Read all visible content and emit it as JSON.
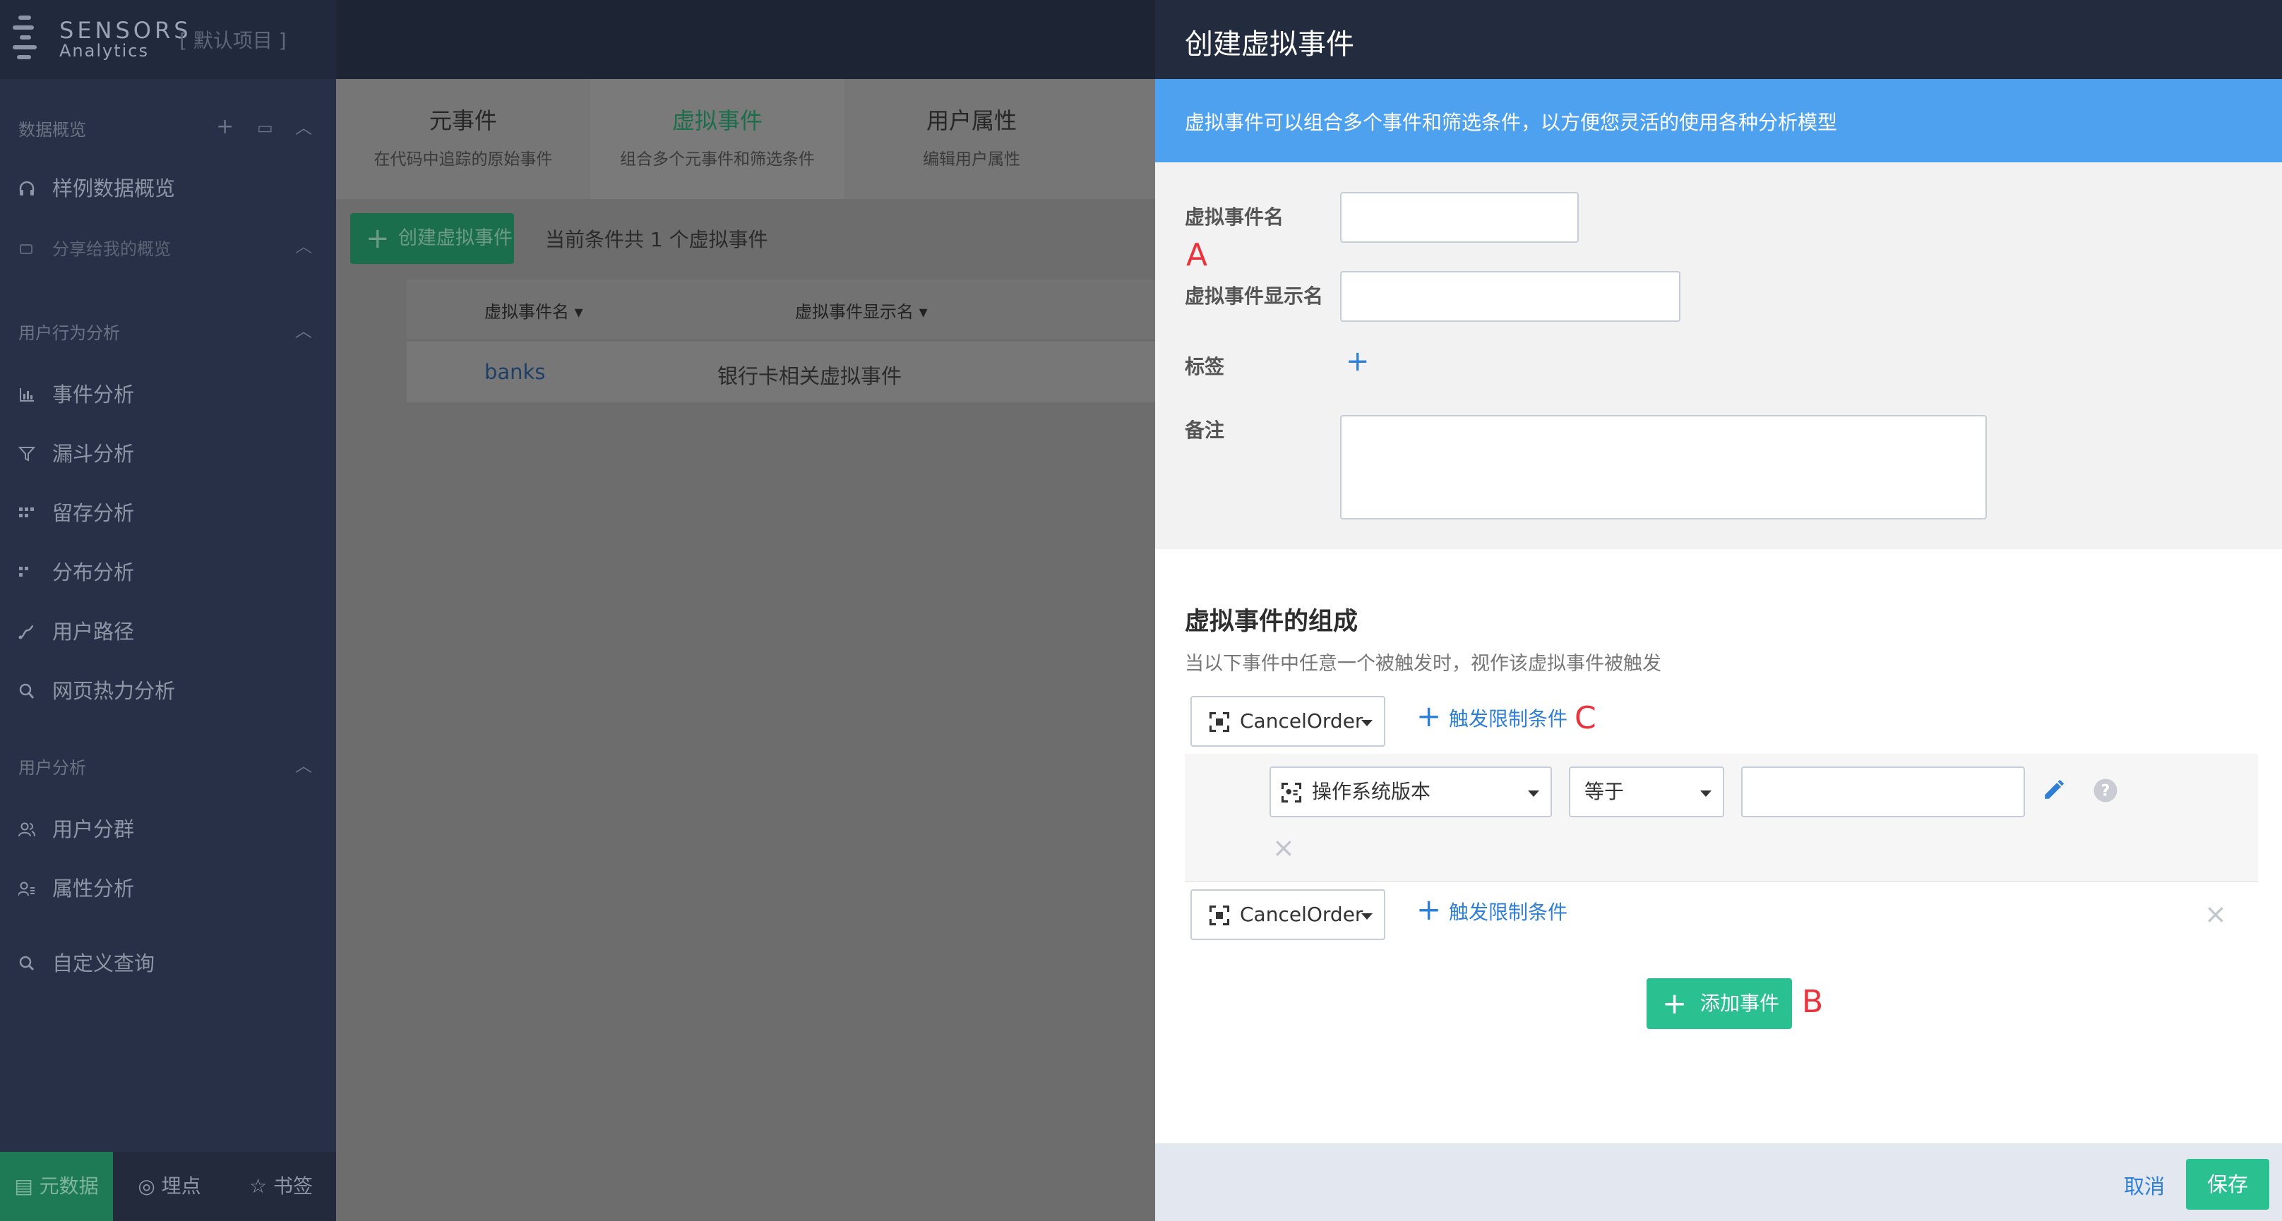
{
  "app": {
    "logo_name": "SENSORS",
    "logo_sub": "Analytics",
    "project": "[ 默认项目 ]"
  },
  "sidebar": {
    "sections": [
      {
        "title": "数据概览",
        "items": [
          {
            "label": "样例数据概览",
            "icon": "headphones-icon"
          },
          {
            "label": "分享给我的概览",
            "icon": "share-icon"
          }
        ]
      },
      {
        "title": "用户行为分析",
        "items": [
          {
            "label": "事件分析",
            "icon": "bar-chart-icon"
          },
          {
            "label": "漏斗分析",
            "icon": "funnel-icon"
          },
          {
            "label": "留存分析",
            "icon": "retention-icon"
          },
          {
            "label": "分布分析",
            "icon": "distribution-icon"
          },
          {
            "label": "用户路径",
            "icon": "path-icon"
          },
          {
            "label": "网页热力分析",
            "icon": "heatmap-icon"
          }
        ]
      },
      {
        "title": "用户分析",
        "items": [
          {
            "label": "用户分群",
            "icon": "users-icon"
          },
          {
            "label": "属性分析",
            "icon": "user-attr-icon"
          }
        ]
      },
      {
        "title": "",
        "items": [
          {
            "label": "自定义查询",
            "icon": "search-icon"
          }
        ]
      }
    ],
    "bottom_tabs": [
      {
        "label": "元数据",
        "icon": "metadata-icon",
        "active": true
      },
      {
        "label": "埋点",
        "icon": "target-icon",
        "active": false
      },
      {
        "label": "书签",
        "icon": "star-icon",
        "active": false
      }
    ]
  },
  "main": {
    "tabs": [
      {
        "title": "元事件",
        "subtitle": "在代码中追踪的原始事件",
        "active": false
      },
      {
        "title": "虚拟事件",
        "subtitle": "组合多个元事件和筛选条件",
        "active": true
      },
      {
        "title": "用户属性",
        "subtitle": "编辑用户属性",
        "active": false
      }
    ],
    "create_button": "创建虚拟事件",
    "count_text": "当前条件共 1 个虚拟事件",
    "table": {
      "headers": [
        "虚拟事件名",
        "虚拟事件显示名"
      ],
      "rows": [
        [
          "banks",
          "银行卡相关虚拟事件"
        ]
      ]
    }
  },
  "drawer": {
    "title": "创建虚拟事件",
    "info": "虚拟事件可以组合多个事件和筛选条件，以方便您灵活的使用各种分析模型",
    "form": {
      "name_label": "虚拟事件名",
      "name_value": "",
      "display_label": "虚拟事件显示名",
      "display_value": "",
      "tag_label": "标签",
      "note_label": "备注",
      "note_value": ""
    },
    "composition": {
      "title": "虚拟事件的组成",
      "desc": "当以下事件中任意一个被触发时，视作该虚拟事件被触发",
      "events": [
        {
          "event": "CancelOrder",
          "trigger_label": "触发限制条件",
          "conditions": [
            {
              "property": "操作系统版本",
              "operator": "等于",
              "value": ""
            }
          ]
        },
        {
          "event": "CancelOrder",
          "trigger_label": "触发限制条件",
          "conditions": []
        }
      ],
      "add_event": "添加事件"
    },
    "markers": {
      "a": "A",
      "b": "B",
      "c": "C"
    },
    "footer": {
      "cancel": "取消",
      "save": "保存"
    }
  },
  "colors": {
    "accent_green": "#2bc08f",
    "link_blue": "#2f7fd6",
    "info_blue": "#4da1ef",
    "header_dark": "#232b3f",
    "marker_red": "#e8323c"
  }
}
